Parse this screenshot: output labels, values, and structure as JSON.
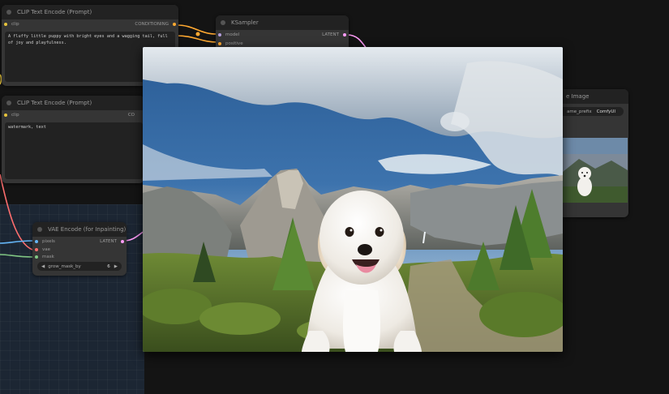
{
  "nodes": {
    "clip_positive": {
      "title": "CLIP Text Encode (Prompt)",
      "input": "clip",
      "output": "CONDITIONING",
      "text": "A fluffy little puppy with bright eyes and a wagging tail, full of joy and playfulness."
    },
    "clip_negative": {
      "title": "CLIP Text Encode (Prompt)",
      "input": "clip",
      "output": "CO",
      "text": "watermark, text"
    },
    "ksampler": {
      "title": "KSampler",
      "inputs": [
        "model",
        "positive"
      ],
      "output": "LATENT"
    },
    "vae_encode": {
      "title": "VAE Encode (for Inpainting)",
      "inputs": [
        "pixels",
        "vae",
        "mask"
      ],
      "output": "LATENT",
      "widget_name": "grow_mask_by",
      "widget_value": "6"
    },
    "save_image": {
      "title": "e Image",
      "widget_name": "ame_prefix",
      "widget_value": "ComfyUI"
    }
  },
  "colors": {
    "canvas": "#141414",
    "node_body": "#353535",
    "node_title": "#222222",
    "clip_slot": "#e6c33c",
    "conditioning_slot": "#ffa931",
    "model_slot": "#b39ddb",
    "latent_slot": "#ff9cf9",
    "vae_slot": "#ff6e6e",
    "image_slot": "#64b5f6",
    "mask_slot": "#81c784",
    "group": "#1c2633"
  },
  "icons": {
    "decrement": "triangle-left",
    "increment": "triangle-right"
  }
}
